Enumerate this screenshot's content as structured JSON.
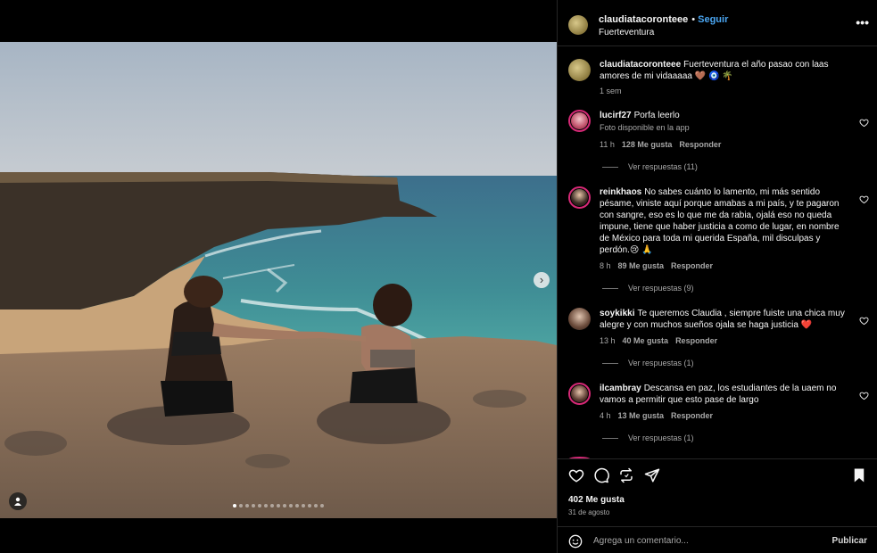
{
  "post": {
    "username": "claudiatacoronteee",
    "separator": "•",
    "follow_label": "Seguir",
    "location": "Fuerteventura",
    "more_label": "•••"
  },
  "caption": {
    "username": "claudiatacoronteee",
    "text": "Fuerteventura el año pasao con laas amores de mi vidaaaaa 🤎 🧿 🌴",
    "time": "1 sem"
  },
  "comments": [
    {
      "username": "lucirf27",
      "text": "Porfa leerlo",
      "sub": "Foto disponible en la app",
      "time": "11 h",
      "likes": "128 Me gusta",
      "reply_label": "Responder",
      "view_replies": "Ver respuestas (11)"
    },
    {
      "username": "reinkhaos",
      "text": "No sabes cuánto lo lamento, mi más sentido pésame, viniste aquí porque amabas a mi país, y te pagaron con sangre, eso es lo que me da rabia, ojalá eso no queda impune, tiene que haber justicia a como de lugar, en nombre de México para toda mi querida España, mil disculpas y perdón.😢 🙏",
      "time": "8 h",
      "likes": "89 Me gusta",
      "reply_label": "Responder",
      "view_replies": "Ver respuestas (9)"
    },
    {
      "username": "soykikki",
      "text": "Te queremos Claudia , siempre fuiste una chica muy alegre y con muchos sueños ojala se haga justicia ❤️",
      "time": "13 h",
      "likes": "40 Me gusta",
      "reply_label": "Responder",
      "view_replies": "Ver respuestas (1)"
    },
    {
      "username": "ilcambray",
      "text": "Descansa en paz, los estudiantes de la uaem no vamos a permitir que esto pase de largo",
      "time": "4 h",
      "likes": "13 Me gusta",
      "reply_label": "Responder",
      "view_replies": "Ver respuestas (1)"
    }
  ],
  "stats": {
    "likes": "402 Me gusta",
    "date": "31 de agosto"
  },
  "composer": {
    "placeholder": "Agrega un comentario...",
    "post_label": "Publicar"
  },
  "carousel": {
    "slide_count": 15,
    "active_index": 0
  },
  "icons": {
    "like": "heart-icon",
    "comment": "comment-icon",
    "share": "share-icon",
    "send": "send-icon",
    "save": "bookmark-icon",
    "emoji": "emoji-icon",
    "tag": "user-tag-icon",
    "next": "chevron-right-icon"
  },
  "colors": {
    "follow": "#4aa5f0",
    "story_ring": "#d62976",
    "background": "#000000"
  }
}
